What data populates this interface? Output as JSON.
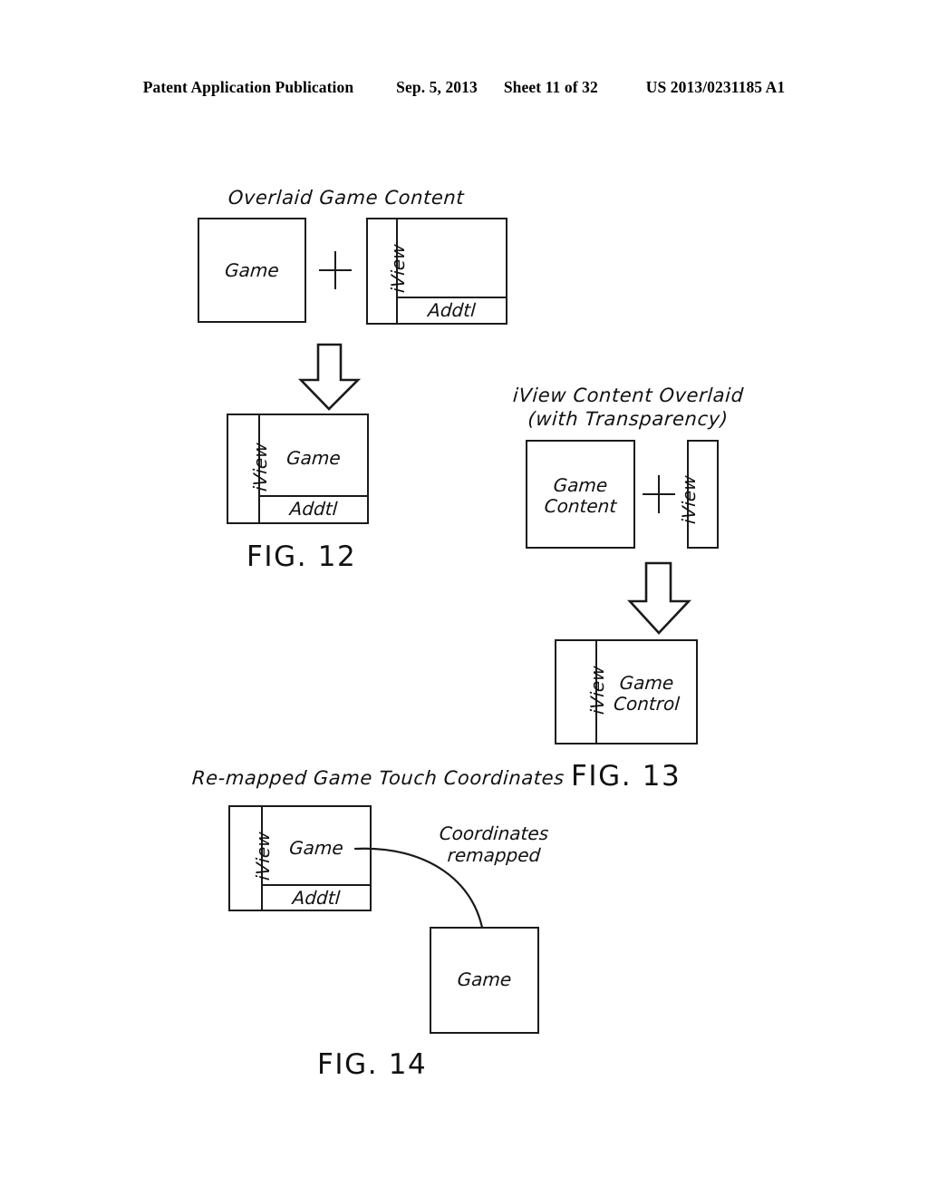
{
  "header": {
    "publication": "Patent Application Publication",
    "date": "Sep. 5, 2013",
    "sheet": "Sheet 11 of 32",
    "doc_number": "US 2013/0231185 A1"
  },
  "figures": [
    {
      "id": "fig12",
      "caption": "FIG. 12",
      "title": "Overlaid Game Content",
      "operator": "+",
      "inputs": [
        {
          "name": "game-box",
          "label": "Game"
        },
        {
          "name": "iview-addtl-box",
          "side_label": "iView",
          "bottom_label": "Addtl"
        }
      ],
      "result": {
        "side_label": "iView",
        "main_label": "Game",
        "bottom_label": "Addtl"
      }
    },
    {
      "id": "fig13",
      "caption": "FIG. 13",
      "title_line1": "iView Content Overlaid",
      "title_line2": "(with Transparency)",
      "operator": "+",
      "inputs": [
        {
          "name": "game-content-box",
          "label_line1": "Game",
          "label_line2": "Content"
        },
        {
          "name": "iview-strip-box",
          "side_label": "iView"
        }
      ],
      "result": {
        "side_label": "iView",
        "main_label_line1": "Game",
        "main_label_line2": "Control"
      }
    },
    {
      "id": "fig14",
      "caption": "FIG. 14",
      "title": "Re-mapped Game Touch Coordinates",
      "source": {
        "side_label": "iView",
        "main_label": "Game",
        "bottom_label": "Addtl"
      },
      "annotation_line1": "Coordinates",
      "annotation_line2": "remapped",
      "target": {
        "label": "Game"
      }
    }
  ],
  "colors": {
    "ink": "#1a1a1a",
    "paper": "#ffffff"
  }
}
